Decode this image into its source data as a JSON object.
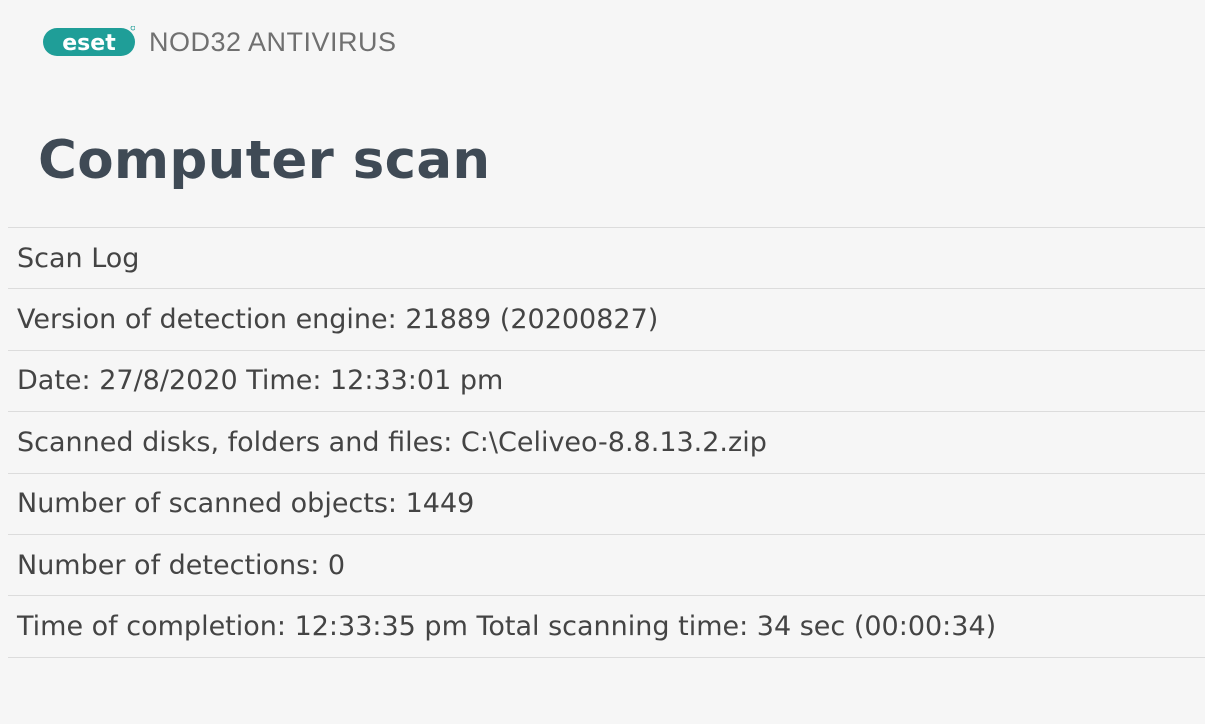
{
  "header": {
    "logo_text": "eset",
    "logo_color": "#1f9e98",
    "product_name": "NOD32 ANTIVIRUS"
  },
  "page": {
    "title": "Computer scan"
  },
  "log": {
    "rows": [
      "Scan Log",
      "Version of detection engine: 21889 (20200827)",
      "Date: 27/8/2020  Time: 12:33:01 pm",
      "Scanned disks, folders and files: C:\\Celiveo-8.8.13.2.zip",
      "Number of scanned objects: 1449",
      "Number of detections: 0",
      "Time of completion: 12:33:35 pm  Total scanning time: 34 sec (00:00:34)"
    ]
  }
}
